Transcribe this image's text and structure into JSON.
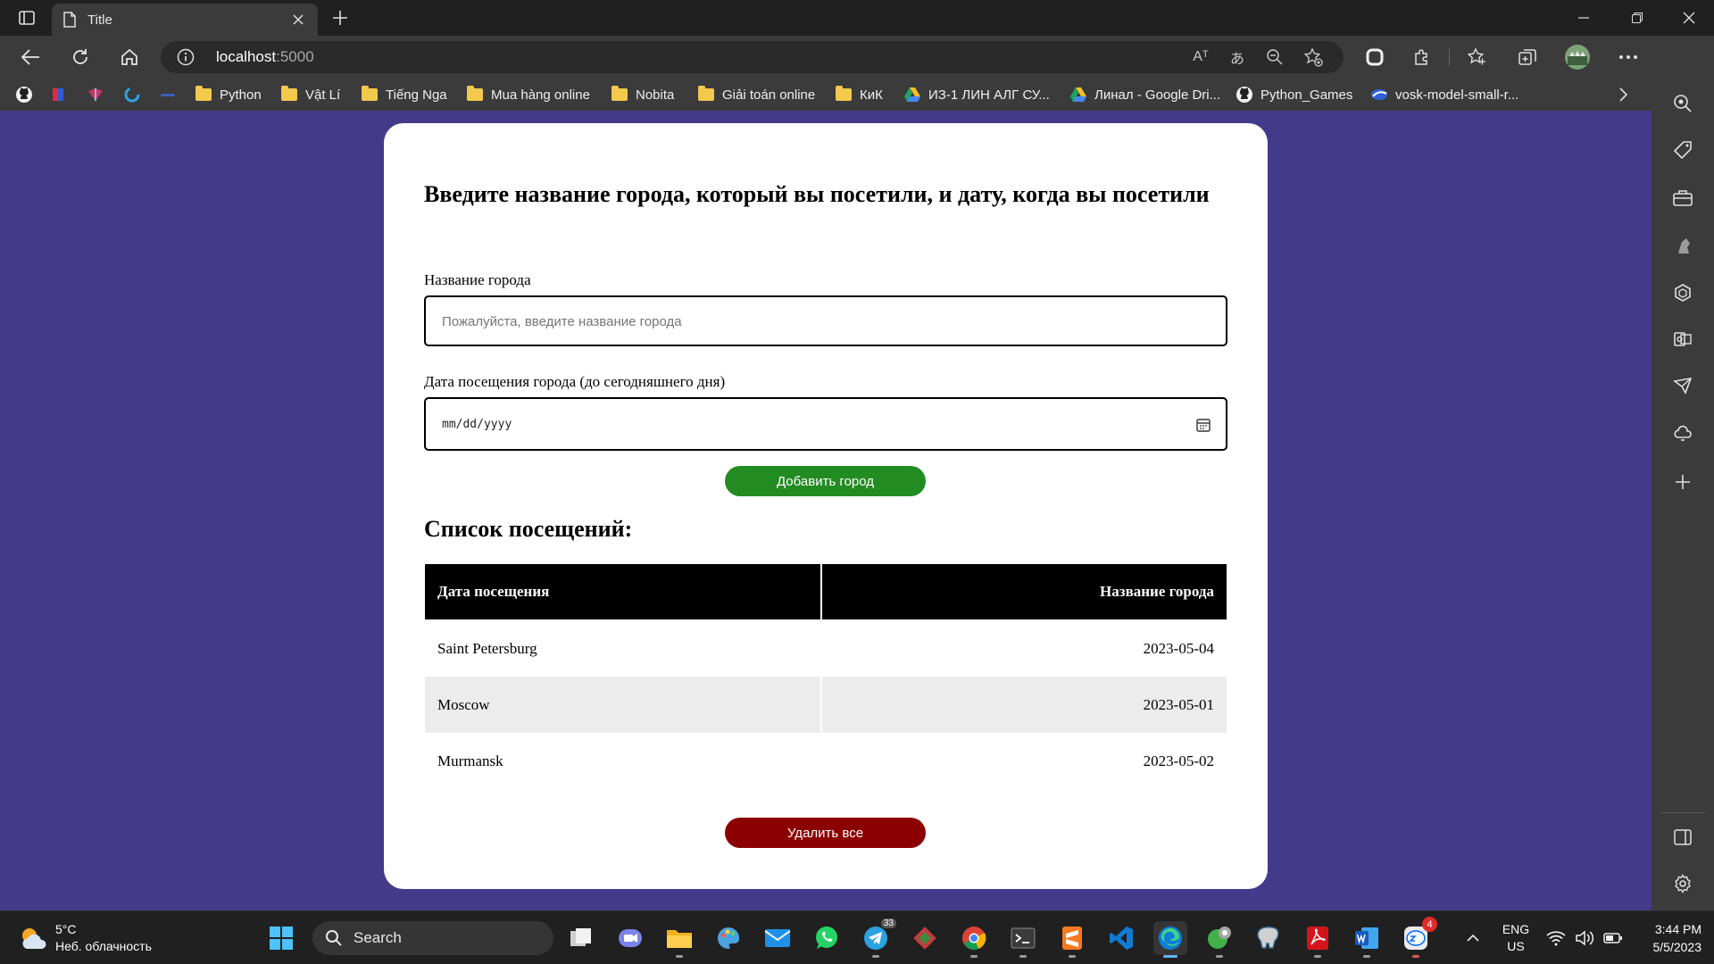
{
  "browser": {
    "tab_title": "Title",
    "url_host": "localhost",
    "url_port": ":5000",
    "read_aloud_glyph": "Aᵀ",
    "translate_glyph": "あ"
  },
  "favorites": [
    {
      "label": "Python",
      "icon": "folder-icon"
    },
    {
      "label": "Vật Lí",
      "icon": "folder-icon"
    },
    {
      "label": "Tiếng Nga",
      "icon": "folder-icon"
    },
    {
      "label": "Mua hàng online",
      "icon": "folder-icon"
    },
    {
      "label": "Nobita",
      "icon": "folder-icon"
    },
    {
      "label": "Giải toán online",
      "icon": "folder-icon"
    },
    {
      "label": "КиК",
      "icon": "folder-icon"
    },
    {
      "label": "ИЗ-1 ЛИН АЛГ СУ...",
      "icon": "google-drive-icon"
    },
    {
      "label": "Линал - Google Dri...",
      "icon": "google-drive-icon"
    },
    {
      "label": "Python_Games",
      "icon": "github-icon"
    },
    {
      "label": "vosk-model-small-r...",
      "icon": "website-icon"
    }
  ],
  "page": {
    "heading": "Введите название города, который вы посетили, и дату, когда вы посетили",
    "city_label": "Название города",
    "city_placeholder": "Пожалуйста, введите название города",
    "date_label": "Дата посещения города (до сегодняшнего дня)",
    "date_placeholder": "mm/dd/yyyy",
    "add_button": "Добавить город",
    "list_heading": "Список посещений:",
    "table": {
      "headers": [
        "Дата посещения",
        "Название города"
      ],
      "rows": [
        [
          "Saint Petersburg",
          "2023-05-04"
        ],
        [
          "Moscow",
          "2023-05-01"
        ],
        [
          "Murmansk",
          "2023-05-02"
        ]
      ]
    },
    "delete_button": "Удалить все",
    "colors": {
      "background": "#433b89",
      "add_button": "#228b22",
      "delete_button": "#8b0000"
    }
  },
  "taskbar": {
    "weather_temp": "5°C",
    "weather_desc": "Неб. облачность",
    "search_label": "Search",
    "telegram_badge": "33",
    "zalo_badge": "4",
    "lang_line1": "ENG",
    "lang_line2": "US",
    "time": "3:44 PM",
    "date": "5/5/2023"
  }
}
